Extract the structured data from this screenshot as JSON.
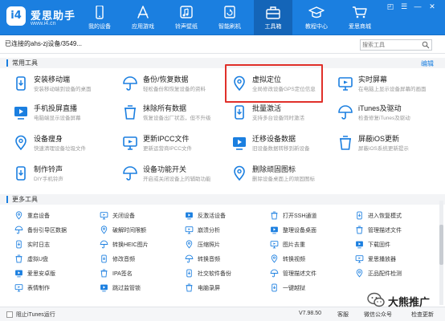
{
  "header": {
    "logo_mark": "i4",
    "app_name": "爱思助手",
    "url": "www.i4.cn",
    "nav": [
      {
        "label": "我的设备",
        "icon": "phone-icon"
      },
      {
        "label": "应用游戏",
        "icon": "app-store-icon"
      },
      {
        "label": "铃声壁纸",
        "icon": "music-icon"
      },
      {
        "label": "智能刷机",
        "icon": "smart-flash-icon"
      },
      {
        "label": "工具箱",
        "icon": "toolbox-icon",
        "active": true
      },
      {
        "label": "教程中心",
        "icon": "graduation-cap-icon"
      },
      {
        "label": "爱思商城",
        "icon": "cart-icon"
      }
    ],
    "window_controls": [
      "◰",
      "☰",
      "—",
      "✕"
    ],
    "colors": {
      "bar": "#1b7fe0",
      "active_tab": "#1465b8",
      "highlight": "#e0302a"
    }
  },
  "toolbar": {
    "device_tab": "已连接的ahs-zj设备/3549...",
    "search_placeholder": "搜索工具"
  },
  "common_tools": {
    "title": "常用工具",
    "edit": "编辑",
    "items": [
      {
        "title": "安装移动端",
        "desc": "安装移动端到设备的桌面",
        "icon": "install-mobile-icon"
      },
      {
        "title": "备份/恢复数据",
        "desc": "轻松备份和恢复设备的资料",
        "icon": "umbrella-backup-icon"
      },
      {
        "title": "虚拟定位",
        "desc": "全局修改设备GPS定位信息",
        "icon": "location-pin-icon",
        "highlighted": true
      },
      {
        "title": "实时屏幕",
        "desc": "在电脑上显示设备屏幕的画面",
        "icon": "live-screen-icon"
      },
      {
        "title": "手机投屏直播",
        "desc": "电脑端显示设备屏幕",
        "icon": "screen-cast-icon"
      },
      {
        "title": "抹除所有数据",
        "desc": "恢复设备出厂状态，但不升级",
        "icon": "erase-data-icon"
      },
      {
        "title": "批量激活",
        "desc": "支持多台设备同时激活",
        "icon": "batch-activate-icon"
      },
      {
        "title": "iTunes及驱动",
        "desc": "检查修复iTunes及驱动",
        "icon": "itunes-icon"
      },
      {
        "title": "设备瘦身",
        "desc": "快速清理设备垃圾文件",
        "icon": "device-slim-icon"
      },
      {
        "title": "更新IPCC文件",
        "desc": "更新运营商IPCC文件",
        "icon": "ipcc-file-icon"
      },
      {
        "title": "迁移设备数据",
        "desc": "旧设备数据转移到新设备",
        "icon": "migrate-data-icon"
      },
      {
        "title": "屏蔽iOS更新",
        "desc": "屏蔽iOS系统更新提示",
        "icon": "block-update-icon"
      },
      {
        "title": "制作铃声",
        "desc": "DIY手机铃声",
        "icon": "ringtone-icon"
      },
      {
        "title": "设备功能开关",
        "desc": "开启或关闭设备上的辅助功能",
        "icon": "feature-toggle-icon"
      },
      {
        "title": "删除顽固图标",
        "desc": "删除设备桌面上的顽固图标",
        "icon": "delete-icon-grid-icon"
      }
    ]
  },
  "more_tools": {
    "title": "更多工具",
    "items": [
      {
        "label": "重启设备",
        "icon": "restart-icon"
      },
      {
        "label": "关闭设备",
        "icon": "power-icon"
      },
      {
        "label": "反激活设备",
        "icon": "deactivate-icon"
      },
      {
        "label": "打开SSH通道",
        "icon": "ssh-icon"
      },
      {
        "label": "进入恢复模式",
        "icon": "recovery-mode-icon"
      },
      {
        "label": "备份引导区数据",
        "icon": "bootloader-backup-icon"
      },
      {
        "label": "破解时间限额",
        "icon": "time-limit-icon"
      },
      {
        "label": "崩溃分析",
        "icon": "crash-analysis-icon"
      },
      {
        "label": "整理设备桌面",
        "icon": "desktop-tidy-icon"
      },
      {
        "label": "管理描述文件",
        "icon": "profile-icon"
      },
      {
        "label": "实时日志",
        "icon": "log-icon"
      },
      {
        "label": "转换HEIC图片",
        "icon": "heic-icon"
      },
      {
        "label": "压缩照片",
        "icon": "compress-photo-icon"
      },
      {
        "label": "图片去重",
        "icon": "dedupe-photo-icon"
      },
      {
        "label": "下载固件",
        "icon": "download-firmware-icon"
      },
      {
        "label": "虚拟U盘",
        "icon": "usb-icon"
      },
      {
        "label": "修改音频",
        "icon": "audio-edit-icon"
      },
      {
        "label": "转换音频",
        "icon": "audio-convert-icon"
      },
      {
        "label": "转换视频",
        "icon": "video-convert-icon"
      },
      {
        "label": "爱思播放器",
        "icon": "player-icon"
      },
      {
        "label": "爱思安卓版",
        "icon": "android-icon"
      },
      {
        "label": "IPA签名",
        "icon": "ipa-sign-icon"
      },
      {
        "label": "社交软件备份",
        "icon": "social-backup-icon"
      },
      {
        "label": "管理描述文件",
        "icon": "profile-manage-icon"
      },
      {
        "label": "正品配件检测",
        "icon": "accessory-check-icon"
      },
      {
        "label": "表情制作",
        "icon": "emoji-icon"
      },
      {
        "label": "跳过监管锁",
        "icon": "skip-lock-icon"
      },
      {
        "label": "电脑录屏",
        "icon": "screen-record-icon"
      },
      {
        "label": "一键越狱",
        "icon": "jailbreak-icon"
      },
      {
        "label": "",
        "icon": ""
      }
    ]
  },
  "statusbar": {
    "itunes_label": "阻止iTunes运行",
    "version": "V7.98.50",
    "feedback": "客服",
    "wechat": "微信公众号",
    "check_update": "检查更新"
  },
  "watermark": "大熊推广"
}
